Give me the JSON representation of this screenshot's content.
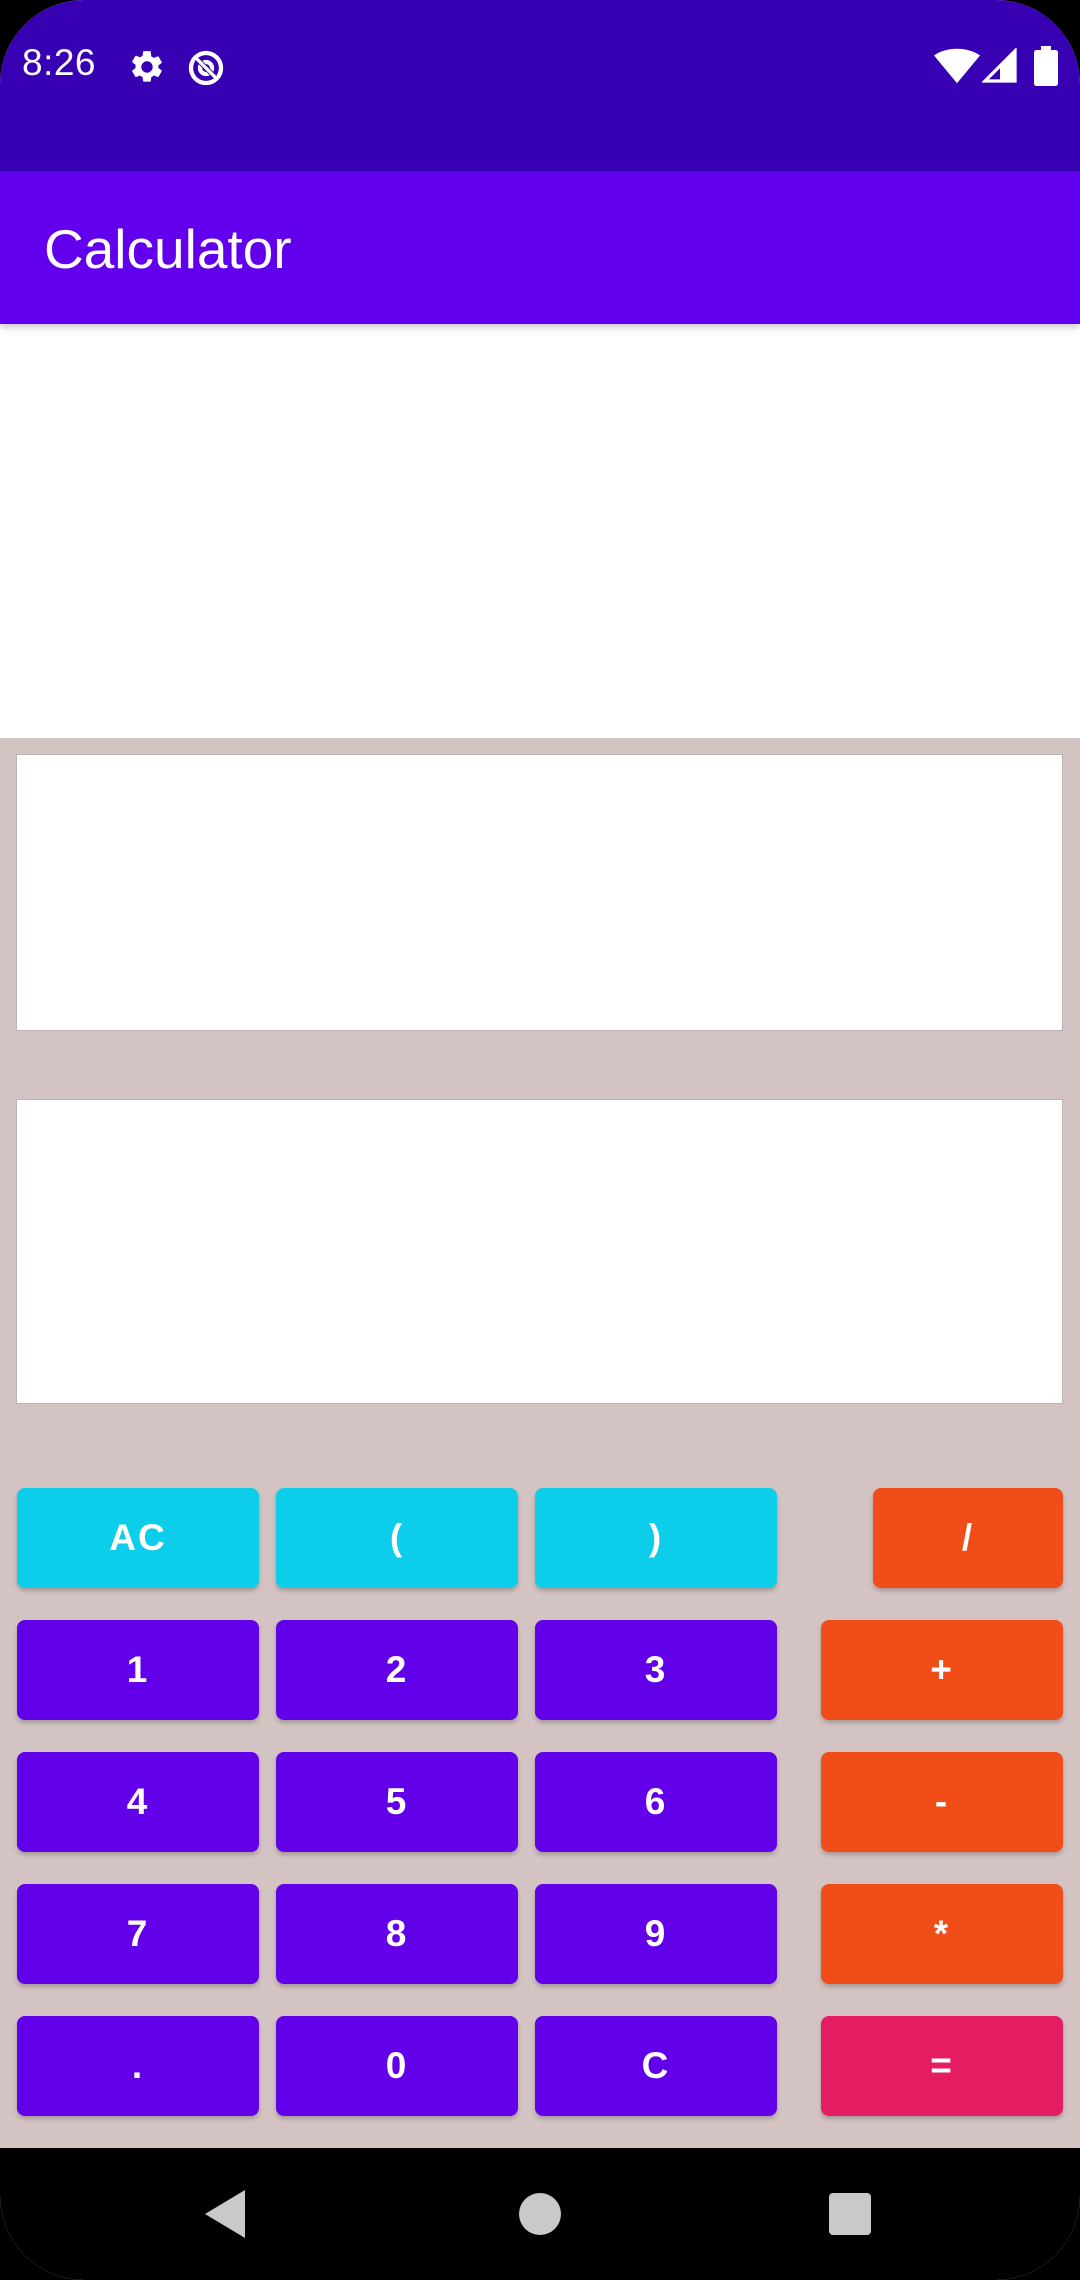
{
  "status_bar": {
    "time": "8:26",
    "icons": [
      "gear-icon",
      "data-saver-icon",
      "wifi-icon",
      "signal-icon",
      "battery-icon"
    ]
  },
  "app_bar": {
    "title": "Calculator"
  },
  "displays": {
    "expression": "",
    "result": ""
  },
  "keypad": {
    "row1": [
      "AC",
      "(",
      ")",
      "/"
    ],
    "row2": [
      "1",
      "2",
      "3",
      "+"
    ],
    "row3": [
      "4",
      "5",
      "6",
      "-"
    ],
    "row4": [
      "7",
      "8",
      "9",
      "*"
    ],
    "row5": [
      ".",
      "0",
      "C",
      "="
    ]
  },
  "colors": {
    "status_bar": "#3700b3",
    "app_bar": "#6200ee",
    "calc_background": "#d3c4c3",
    "function_button": "#0cceea",
    "number_button": "#6200ea",
    "operator_button": "#f14d18",
    "equals_button": "#e41c62"
  },
  "nav_bar": {
    "icons": [
      "back-icon",
      "home-icon",
      "recents-icon"
    ]
  }
}
